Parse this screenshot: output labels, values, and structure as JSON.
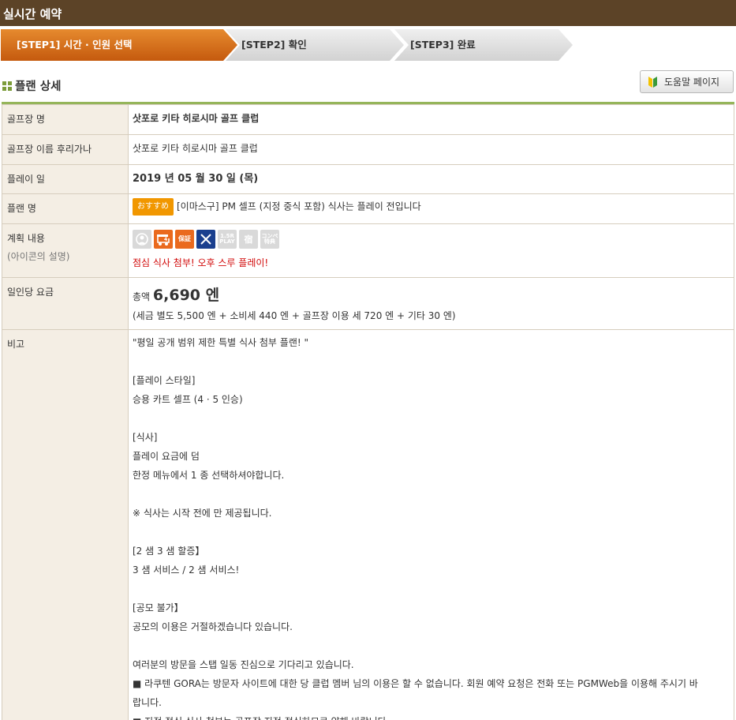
{
  "header": {
    "title": "실시간 예약"
  },
  "steps": [
    {
      "label": "[STEP1] 시간 · 인원 선택"
    },
    {
      "label": "[STEP2] 확인"
    },
    {
      "label": "[STEP3] 완료"
    }
  ],
  "section": {
    "title": "플랜 상세",
    "help_button": "도움말 페이지"
  },
  "rows": {
    "course_name": {
      "label": "골프장 명",
      "value": "삿포로 키타 히로시마 골프 클럽"
    },
    "course_kana": {
      "label": "골프장 이름 후리가나",
      "value": "삿포로 키타 히로시마 골프 클럽"
    },
    "play_date": {
      "label": "플레이 일",
      "value": "2019 년 05 월 30 일 (목)"
    },
    "plan_name": {
      "label": "플랜 명",
      "badge": "おすすめ",
      "value": "[이마스구] PM 셀프 (지정 중식 포함) 식사는 플레이 전입니다"
    },
    "plan_content": {
      "label": "계획 내용",
      "sub_label": "(아이콘의 설명)",
      "icons": [
        {
          "name": "caddie-icon",
          "text": "",
          "state": "off"
        },
        {
          "name": "cart-icon",
          "text": "4",
          "state": "on"
        },
        {
          "name": "guarantee-icon",
          "text": "保証",
          "state": "on"
        },
        {
          "name": "meal-icon",
          "text": "",
          "state": "blue"
        },
        {
          "name": "1-5r-play-icon",
          "text": "1.5R PLAY",
          "state": "off"
        },
        {
          "name": "lodging-icon",
          "text": "宿",
          "state": "off"
        },
        {
          "name": "competition-icon",
          "text": "コンペ特典",
          "state": "off"
        }
      ],
      "note": "점심 식사 첨부! 오후 스루 플레이!"
    },
    "price": {
      "label": "일인당 요금",
      "total_prefix": "총액",
      "total": "6,690 엔",
      "breakdown": "(세금 별도 5,500 엔 + 소비세 440 엔 + 골프장 이용 세 720 엔 + 기타 30 엔)"
    },
    "remarks": {
      "label": "비고",
      "lines": [
        "\"평일 공개 범위 제한 특별 식사 첨부 플랜! \"",
        "",
        "[플레이 스타일]",
        "승용 카트 셀프 (4 · 5 인승)",
        "",
        "[식사]",
        "플레이 요금에 덤",
        "한정 메뉴에서 1 종 선택하셔야합니다.",
        "",
        "※ 식사는 시작 전에 만 제공됩니다.",
        "",
        "[2 샘 3 샘 할증】",
        "3 샘 서비스 / 2 샘 서비스!",
        "",
        "[공모 불가】",
        "공모의 이용은 거절하겠습니다 있습니다.",
        "",
        "여러분의 방문을 스탭 일동 진심으로 기다리고 있습니다.",
        "■ 라쿠텐 GORA는 방문자 사이트에 대한 당 클럽 멤버 님의 이용은 할 수 없습니다. 회원 예약 요청은 전화 또는 PGMWeb을 이용해 주시기 바",
        "랍니다.",
        "■ 지정 점심 식사 첨부는 골프장 지정 점심하므로 양해 바랍니다."
      ]
    }
  }
}
